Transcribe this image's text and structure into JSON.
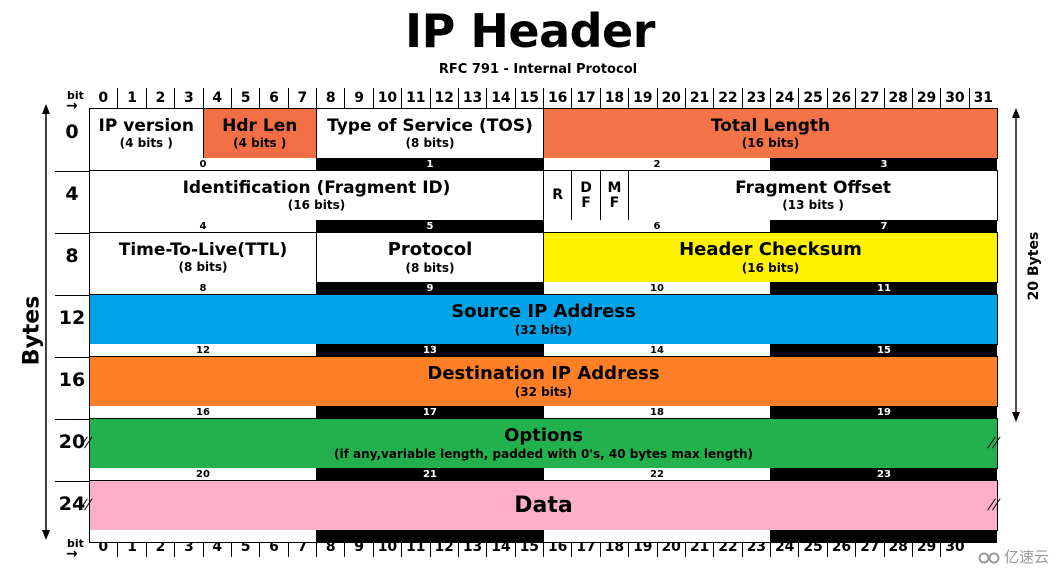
{
  "title": "IP Header",
  "subtitle": "RFC 791 - Internal Protocol",
  "bit_axis": {
    "label": "bit",
    "arrow": "→",
    "bits": [
      "0",
      "1",
      "2",
      "3",
      "4",
      "5",
      "6",
      "7",
      "8",
      "9",
      "10",
      "11",
      "12",
      "13",
      "14",
      "15",
      "16",
      "17",
      "18",
      "19",
      "20",
      "21",
      "22",
      "23",
      "24",
      "25",
      "26",
      "27",
      "28",
      "29",
      "30",
      "31"
    ],
    "bottom_bits_visible": [
      "0",
      "1",
      "2",
      "3",
      "4",
      "5",
      "6",
      "7",
      "8",
      "9",
      "10",
      "11",
      "12",
      "13",
      "14",
      "15",
      "16",
      "17",
      "18",
      "19",
      "20",
      "21",
      "22",
      "23",
      "24",
      "25",
      "26",
      "27",
      "28",
      "29",
      "30"
    ]
  },
  "left_axis_label": "Bytes",
  "right_axis_label": "20 Bytes",
  "colors": {
    "hdr_len": "#f26f45",
    "total_length": "#f47448",
    "header_checksum": "#fff200",
    "source_ip": "#00a2e8",
    "destination_ip": "#ff7f27",
    "options": "#22b14c",
    "data": "#ffaec9",
    "white": "#ffffff",
    "black": "#000000"
  },
  "rows": [
    {
      "offset": "0",
      "fields": [
        {
          "name": "IP version",
          "bits": "(4 bits )",
          "start": 0,
          "width": 4,
          "color": "white"
        },
        {
          "name": "Hdr Len",
          "bits": "(4 bits )",
          "start": 4,
          "width": 4,
          "color": "hdr_len"
        },
        {
          "name": "Type of Service (TOS)",
          "bits": "(8 bits)",
          "start": 8,
          "width": 8,
          "color": "white"
        },
        {
          "name": "Total Length",
          "bits": "(16 bits)",
          "start": 16,
          "width": 16,
          "color": "total_length"
        }
      ],
      "bytes": [
        "0",
        "1",
        "2",
        "3"
      ]
    },
    {
      "offset": "4",
      "fields": [
        {
          "name": "Identification (Fragment ID)",
          "bits": "(16 bits)",
          "start": 0,
          "width": 16,
          "color": "white"
        },
        {
          "name": "R",
          "bits": "",
          "start": 16,
          "width": 1,
          "color": "white"
        },
        {
          "name": "D\nF",
          "bits": "",
          "start": 17,
          "width": 1,
          "color": "white"
        },
        {
          "name": "M\nF",
          "bits": "",
          "start": 18,
          "width": 1,
          "color": "white"
        },
        {
          "name": "Fragment Offset",
          "bits": "(13 bits )",
          "start": 19,
          "width": 13,
          "color": "white"
        }
      ],
      "bytes": [
        "4",
        "5",
        "6",
        "7"
      ]
    },
    {
      "offset": "8",
      "fields": [
        {
          "name": "Time-To-Live(TTL)",
          "bits": "(8 bits)",
          "start": 0,
          "width": 8,
          "color": "white"
        },
        {
          "name": "Protocol",
          "bits": "(8 bits)",
          "start": 8,
          "width": 8,
          "color": "white"
        },
        {
          "name": "Header Checksum",
          "bits": "(16 bits)",
          "start": 16,
          "width": 16,
          "color": "header_checksum"
        }
      ],
      "bytes": [
        "8",
        "9",
        "10",
        "11"
      ]
    },
    {
      "offset": "12",
      "fields": [
        {
          "name": "Source IP Address",
          "bits": "(32 bits)",
          "start": 0,
          "width": 32,
          "color": "source_ip"
        }
      ],
      "bytes": [
        "12",
        "13",
        "14",
        "15"
      ]
    },
    {
      "offset": "16",
      "fields": [
        {
          "name": "Destination IP Address",
          "bits": "(32 bits)",
          "start": 0,
          "width": 32,
          "color": "destination_ip"
        }
      ],
      "bytes": [
        "16",
        "17",
        "18",
        "19"
      ]
    },
    {
      "offset": "20",
      "fields": [
        {
          "name": "Options",
          "bits": "(if any,variable length, padded with 0's, 40 bytes max length)",
          "start": 0,
          "width": 32,
          "color": "options"
        }
      ],
      "bytes": [
        "20",
        "21",
        "22",
        "23"
      ],
      "broken": true
    },
    {
      "offset": "24",
      "fields": [
        {
          "name": "Data",
          "bits": "",
          "start": 0,
          "width": 32,
          "color": "data"
        }
      ],
      "bytes": [
        "",
        "",
        "",
        ""
      ],
      "broken": true
    }
  ],
  "watermark": "亿速云",
  "icons": {
    "break_mark": "//",
    "watermark_logo": "cloud-logo"
  }
}
